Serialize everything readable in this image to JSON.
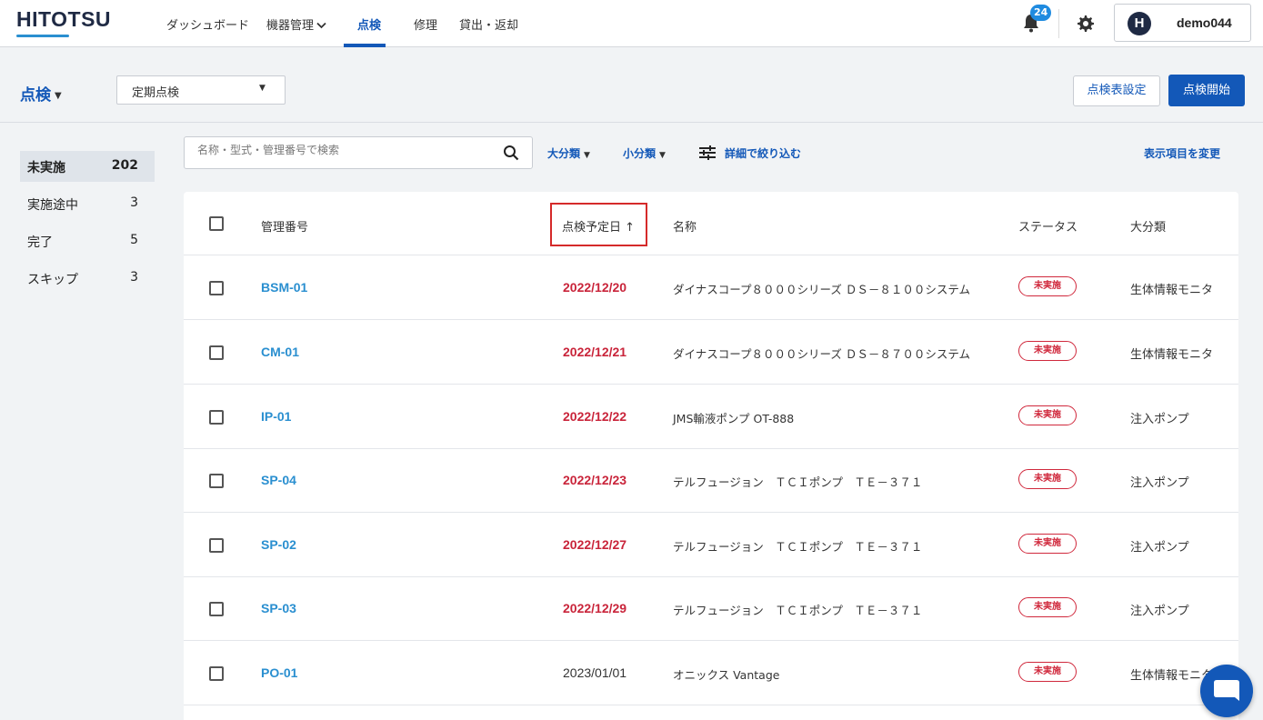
{
  "header": {
    "logo": "HITOTSU",
    "nav": [
      {
        "label": "ダッシュボード"
      },
      {
        "label": "機器管理"
      },
      {
        "label": "点検"
      },
      {
        "label": "修理"
      },
      {
        "label": "貸出・返却"
      }
    ],
    "active_nav": "点検",
    "notification_count": "24",
    "user_initial": "H",
    "user_name": "demo044"
  },
  "subheader": {
    "title": "点検",
    "select_value": "定期点検",
    "settings_button": "点検表設定",
    "start_button": "点検開始"
  },
  "sidebar": {
    "items": [
      {
        "label": "未実施",
        "count": "202",
        "active": true
      },
      {
        "label": "実施途中",
        "count": "3"
      },
      {
        "label": "完了",
        "count": "5"
      },
      {
        "label": "スキップ",
        "count": "3"
      }
    ]
  },
  "toolbar": {
    "search_placeholder": "名称・型式・管理番号で検索",
    "filter_major": "大分類",
    "filter_minor": "小分類",
    "filter_detail": "詳細で絞り込む",
    "change_columns": "表示項目を変更"
  },
  "table": {
    "headers": {
      "mgmt_no": "管理番号",
      "scheduled_date": "点検予定日",
      "sort_arrow": "↑",
      "name": "名称",
      "status": "ステータス",
      "category": "大分類"
    },
    "rows": [
      {
        "mgmt_no": "BSM-01",
        "date": "2022/12/20",
        "overdue": true,
        "name": "ダイナスコープ８０００シリーズ ＤＳ－８１００システム",
        "status": "未実施",
        "category": "生体情報モニタ"
      },
      {
        "mgmt_no": "CM-01",
        "date": "2022/12/21",
        "overdue": true,
        "name": "ダイナスコープ８０００シリーズ ＤＳ－８７００システム",
        "status": "未実施",
        "category": "生体情報モニタ"
      },
      {
        "mgmt_no": "IP-01",
        "date": "2022/12/22",
        "overdue": true,
        "name": "JMS輸液ポンプ OT-888",
        "status": "未実施",
        "category": "注入ポンプ"
      },
      {
        "mgmt_no": "SP-04",
        "date": "2022/12/23",
        "overdue": true,
        "name": "テルフュージョン　ＴＣＩポンプ　ＴＥ－３７１",
        "status": "未実施",
        "category": "注入ポンプ"
      },
      {
        "mgmt_no": "SP-02",
        "date": "2022/12/27",
        "overdue": true,
        "name": "テルフュージョン　ＴＣＩポンプ　ＴＥ－３７１",
        "status": "未実施",
        "category": "注入ポンプ"
      },
      {
        "mgmt_no": "SP-03",
        "date": "2022/12/29",
        "overdue": true,
        "name": "テルフュージョン　ＴＣＩポンプ　ＴＥ－３７１",
        "status": "未実施",
        "category": "注入ポンプ"
      },
      {
        "mgmt_no": "PO-01",
        "date": "2023/01/01",
        "overdue": false,
        "name": "オニックス Vantage",
        "status": "未実施",
        "category": "生体情報モニタ"
      }
    ]
  },
  "colors": {
    "primary": "#1358b8",
    "link": "#2a8fd0",
    "overdue": "#c9243a",
    "highlight_box": "#d52a2a"
  }
}
